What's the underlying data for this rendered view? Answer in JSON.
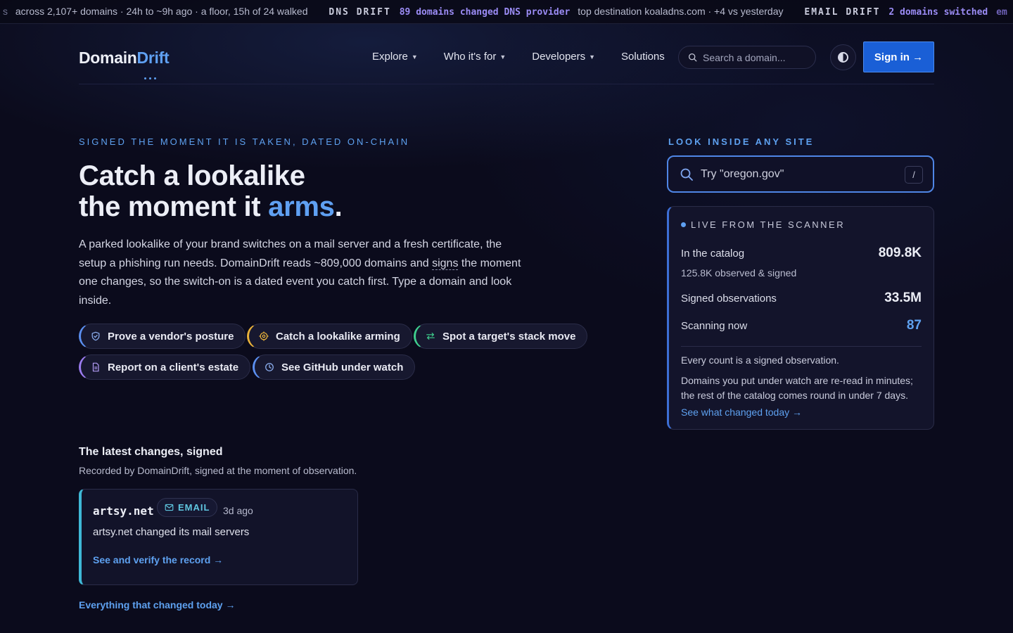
{
  "ticker": {
    "prefix": "s",
    "seg1_text": "across 2,107+ domains · 24h to ~9h ago · a floor, 15h of 24 walked",
    "seg2_tag": "DNS DRIFT",
    "seg2_hl": "89 domains changed DNS provider",
    "seg2_text": "top destination koaladns.com · +4 vs yesterday",
    "seg3_tag": "EMAIL DRIFT",
    "seg3_hl": "2 domains switched",
    "seg3_tail": "em"
  },
  "header": {
    "logo_a": "Domain",
    "logo_b": "Drift",
    "nav": [
      "Explore",
      "Who it's for",
      "Developers",
      "Solutions"
    ],
    "search_placeholder": "Search a domain...",
    "signin_label": "Sign in →"
  },
  "hero": {
    "eyebrow": "SIGNED THE MOMENT IT IS TAKEN, DATED ON-CHAIN",
    "title_line1": "Catch a lookalike",
    "title_line2_pre": "the moment it ",
    "title_line2_accent": "arms",
    "title_line2_post": ".",
    "body_pre": "A parked lookalike of your brand switches on a mail server and a fresh certificate, the setup a phishing run needs. DomainDrift reads ~809,000 domains and ",
    "body_link": "signs",
    "body_post": " the moment one changes, so the switch-on is a dated event you catch first. Type a domain and look inside.",
    "chips": [
      {
        "label": "Prove a vendor's posture",
        "color": "#5b8ff0"
      },
      {
        "label": "Catch a lookalike arming",
        "color": "#e8b13a"
      },
      {
        "label": "Spot a target's stack move",
        "color": "#3fcf8e"
      },
      {
        "label": "Report on a client's estate",
        "color": "#9b7cf0"
      },
      {
        "label": "See GitHub under watch",
        "color": "#5b8ff0"
      }
    ]
  },
  "latest": {
    "heading": "The latest changes, signed",
    "sub": "Recorded by DomainDrift, signed at the moment of observation.",
    "card": {
      "domain": "artsy.net",
      "badge": "EMAIL",
      "ago": "3d ago",
      "desc": "artsy.net changed its mail servers",
      "link": "See and verify the record →"
    },
    "all_link": "Everything that changed today →"
  },
  "side": {
    "look_heading": "LOOK INSIDE ANY SITE",
    "search_placeholder": "Try \"oregon.gov\"",
    "shortcut": "/",
    "scanner": {
      "live_label": "LIVE FROM THE SCANNER",
      "catalog_label": "In the catalog",
      "catalog_value": "809.8K",
      "catalog_sub": "125.8K observed & signed",
      "signed_label": "Signed observations",
      "signed_value": "33.5M",
      "scanning_label": "Scanning now",
      "scanning_value": "87",
      "note1": "Every count is a signed observation.",
      "note2": "Domains you put under watch are re-read in minutes; the rest of the catalog comes round in under 7 days.",
      "link": "See what changed today →"
    }
  }
}
